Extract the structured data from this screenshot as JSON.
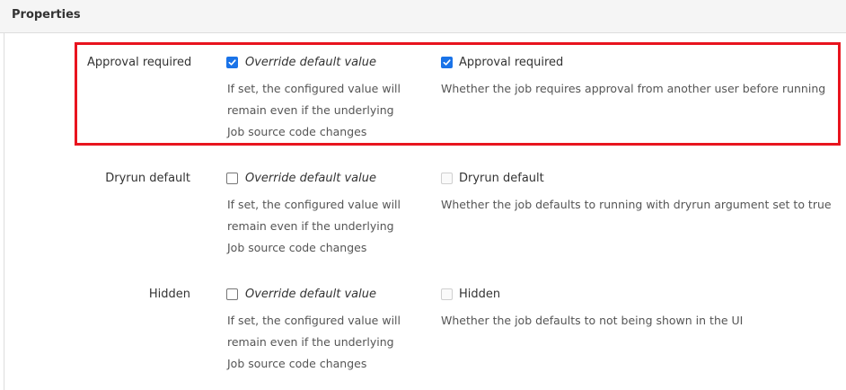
{
  "header": {
    "title": "Properties"
  },
  "override": {
    "label": "Override default value",
    "description": "If set, the configured value will remain even if the underlying Job source code changes"
  },
  "properties": [
    {
      "label": "Approval required",
      "override_checked": true,
      "value_label": "Approval required",
      "value_checked": true,
      "value_enabled": true,
      "description": "Whether the job requires approval from another user before running"
    },
    {
      "label": "Dryrun default",
      "override_checked": false,
      "value_label": "Dryrun default",
      "value_checked": false,
      "value_enabled": false,
      "description": "Whether the job defaults to running with dryrun argument set to true"
    },
    {
      "label": "Hidden",
      "override_checked": false,
      "value_label": "Hidden",
      "value_checked": false,
      "value_enabled": false,
      "description": "Whether the job defaults to not being shown in the UI"
    }
  ],
  "colors": {
    "checkbox_accent": "#1a73e8",
    "highlight_border": "#e8141e"
  }
}
